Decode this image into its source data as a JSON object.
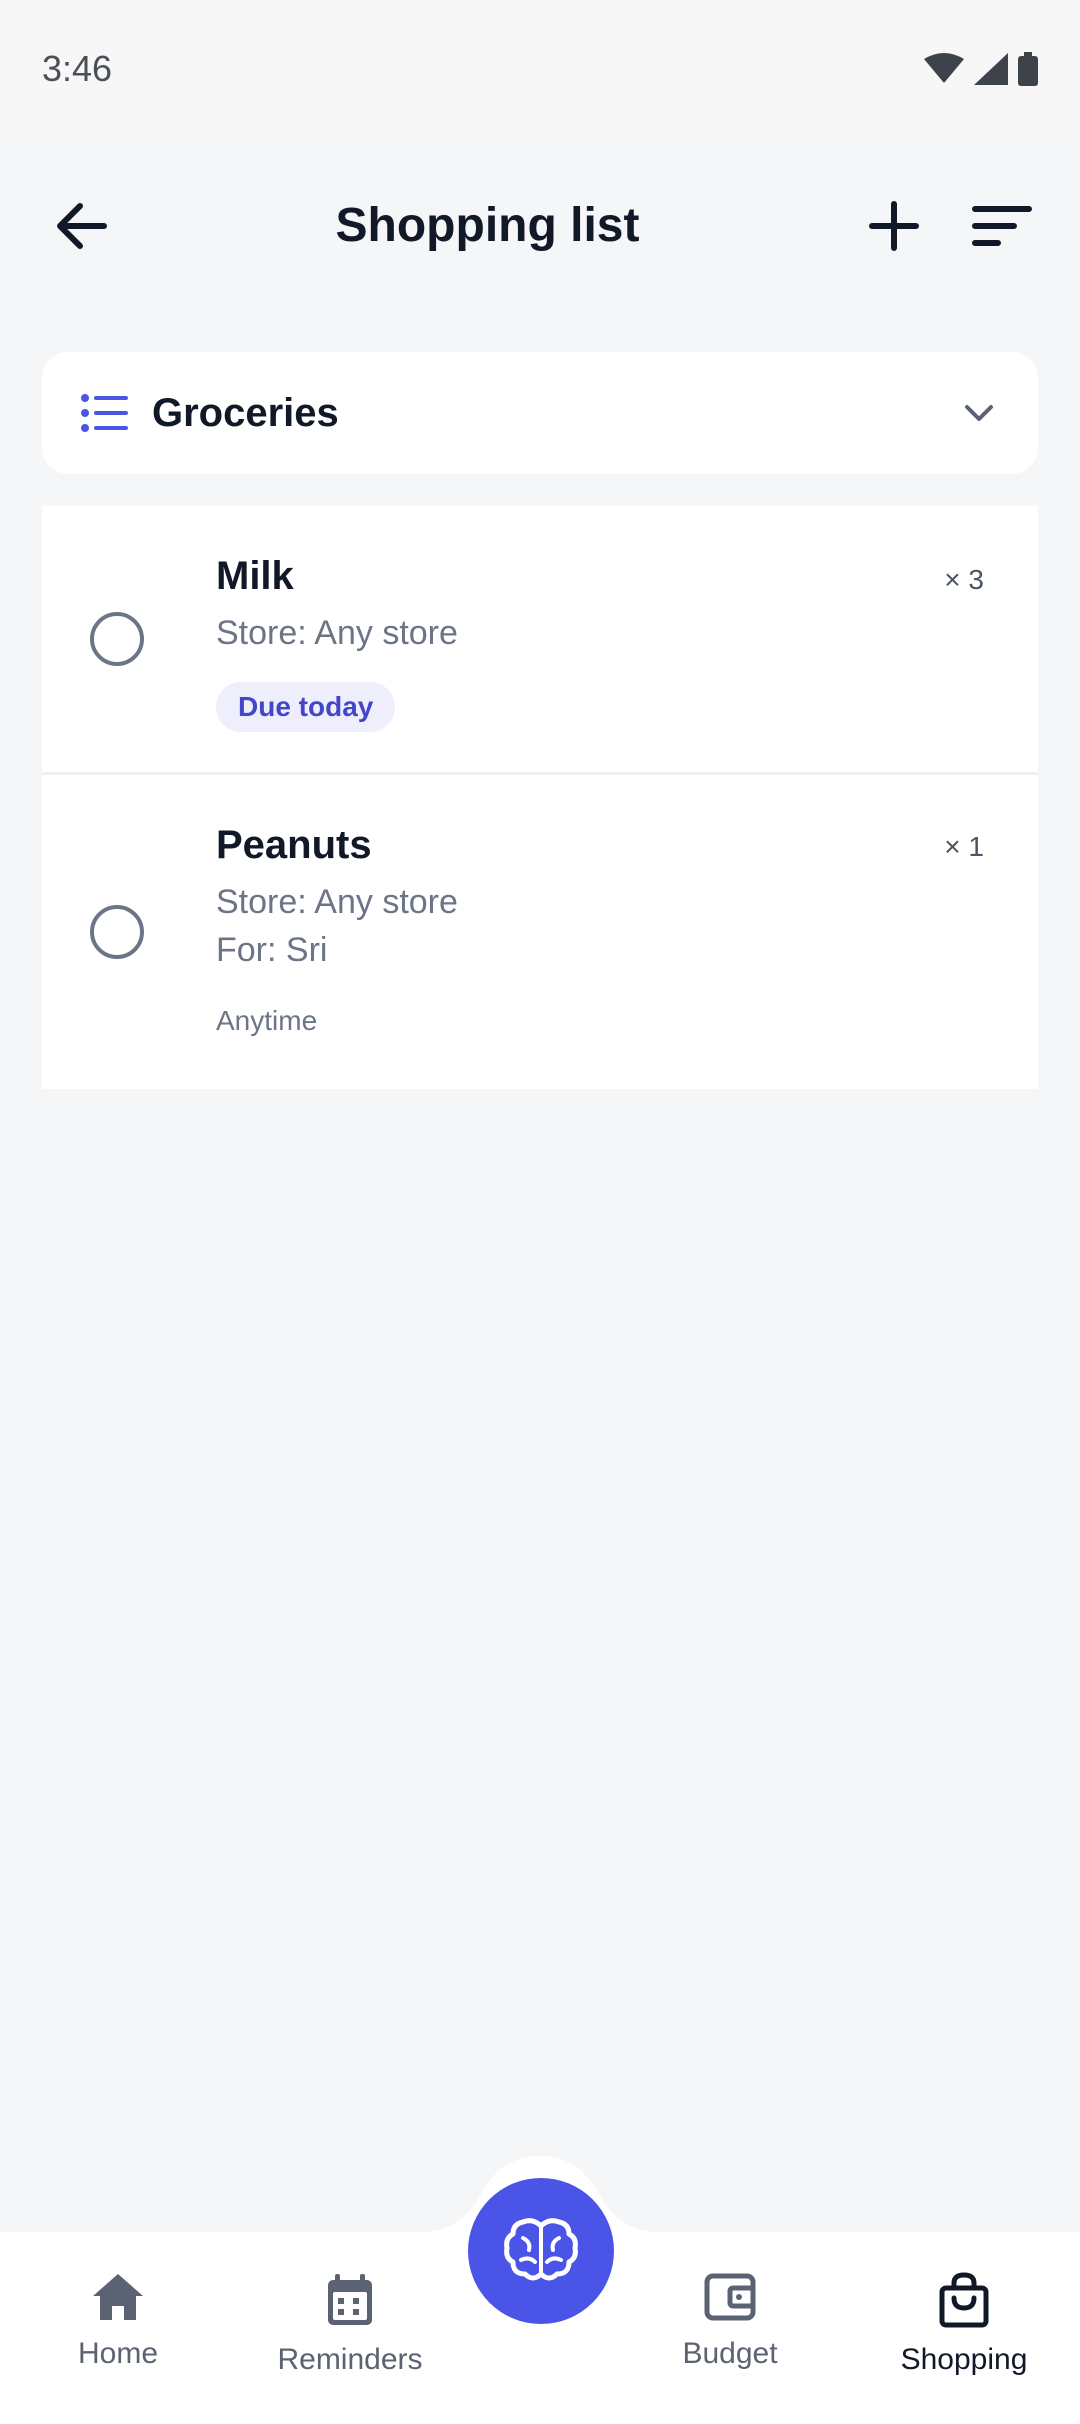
{
  "status_bar": {
    "time": "3:46"
  },
  "header": {
    "title": "Shopping list"
  },
  "list_selector": {
    "label": "Groceries"
  },
  "items": [
    {
      "name": "Milk",
      "quantity": "× 3",
      "store": "Store: Any store",
      "badge": "Due today"
    },
    {
      "name": "Peanuts",
      "quantity": "× 1",
      "store": "Store: Any store",
      "for": "For: Sri",
      "when": "Anytime"
    }
  ],
  "bottom_nav": {
    "items": [
      {
        "label": "Home",
        "icon": "home-icon"
      },
      {
        "label": "Reminders",
        "icon": "calendar-icon"
      },
      {
        "label": "Budget",
        "icon": "wallet-icon"
      },
      {
        "label": "Shopping",
        "icon": "shopping-bag-icon",
        "active": true
      }
    ],
    "fab_icon": "brain-icon"
  },
  "colors": {
    "accent": "#4A55E8",
    "badge_bg": "#EEEEFC",
    "badge_text": "#4346C9"
  }
}
